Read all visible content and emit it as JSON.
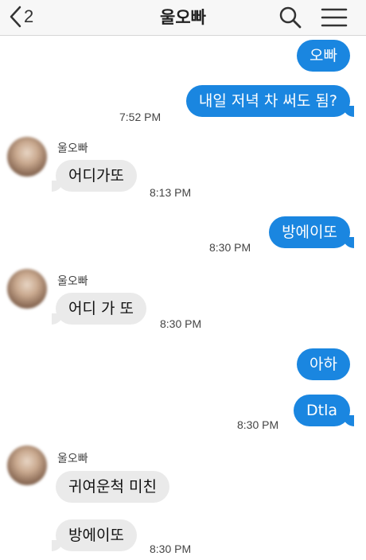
{
  "header": {
    "back_count": "2",
    "title": "울오빠",
    "icons": [
      "back-chevron-icon",
      "search-icon",
      "menu-icon"
    ]
  },
  "colors": {
    "outgoing_bubble": "#1a86e0",
    "incoming_bubble": "#eaeaea",
    "header_bg": "#f7f7f7"
  },
  "messages": [
    {
      "dir": "out",
      "text": "오빠"
    },
    {
      "dir": "out",
      "text": "내일 저녁 차 써도 됨?",
      "time": "7:52 PM"
    },
    {
      "dir": "in",
      "sender": "울오빠",
      "text": "어디가또",
      "time": "8:13 PM"
    },
    {
      "dir": "out",
      "text": "방에이또",
      "time": "8:30 PM"
    },
    {
      "dir": "in",
      "sender": "울오빠",
      "text": "어디 가 또",
      "time": "8:30 PM"
    },
    {
      "dir": "out",
      "text": "아하"
    },
    {
      "dir": "out",
      "text": "Dtla",
      "time": "8:30 PM"
    },
    {
      "dir": "in",
      "sender": "울오빠",
      "text": "귀여운척 미친"
    },
    {
      "dir": "in",
      "text": "방에이또",
      "time": "8:30 PM"
    }
  ]
}
